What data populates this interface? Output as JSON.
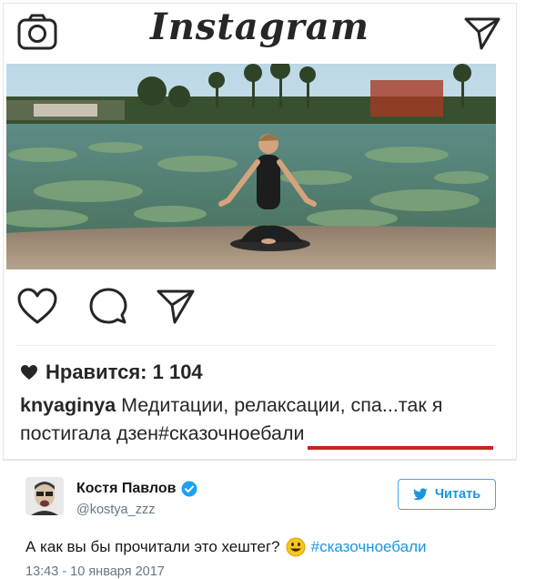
{
  "instagram": {
    "logo_text": "Instagram",
    "header_icons": {
      "left": "camera-icon",
      "right": "paper-plane-icon"
    },
    "action_icons": [
      "heart-icon",
      "comment-icon",
      "share-icon"
    ],
    "likes_text": "Нравится: 1 104",
    "caption": {
      "username": "knyaginya",
      "text": "Медитации, релаксации, спа...так я постигала дзен",
      "hashtag": "#сказочноебали"
    },
    "underline_color": "#c4261d"
  },
  "tweet": {
    "name": "Костя Павлов",
    "handle": "@kostya_zzz",
    "verified_icon": "verified-badge-icon",
    "follow_label": "Читать",
    "follow_icon": "twitter-bird-icon",
    "text": "А как вы бы прочитали это хештег?",
    "emoji": "smiley-icon",
    "hashtag": "#сказочноебали",
    "timestamp": "13:43 - 10 января 2017",
    "accent_color": "#1b95e0"
  }
}
